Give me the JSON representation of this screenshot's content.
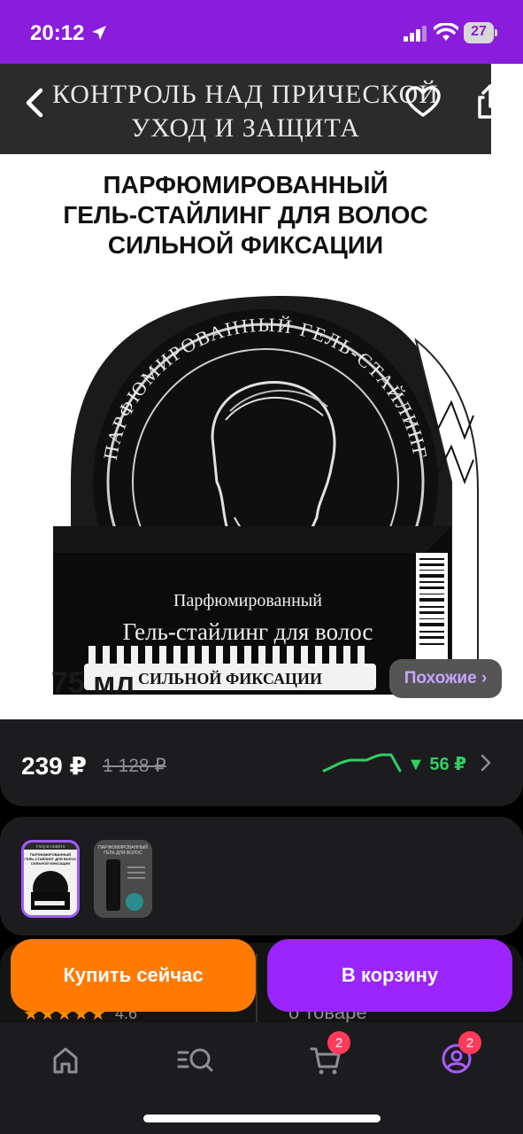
{
  "status_bar": {
    "time": "20:12",
    "battery": "27",
    "icons": [
      "location-arrow-icon",
      "signal-bars-icon",
      "wifi-icon",
      "battery-icon"
    ]
  },
  "product_image": {
    "banner_line1": "КОНТРОЛЬ НАД ПРИЧЕСКОЙ",
    "banner_line2": "УХОД И ЗАЩИТА",
    "title_line1": "ПАРФЮМИРОВАННЫЙ",
    "title_line2": "ГЕЛЬ-СТАЙЛИНГ ДЛЯ ВОЛОС",
    "title_line3": "СИЛЬНОЙ ФИКСАЦИИ",
    "jar_arc_text": "ПАРФЮМИРОВАННЫЙ ГЕЛЬ-СТАЙЛИНГ",
    "box_text1": "Парфюмированный",
    "box_text2": "Гель-стайлинг для волос",
    "box_text3": "СИЛЬНОЙ ФИКСАЦИИ",
    "volume": "75 мл"
  },
  "actions": {
    "similar": "Похожие ›",
    "buy_now": "Купить сейчас",
    "add_to_cart": "В корзину"
  },
  "price": {
    "current": "239 ₽",
    "old": "1 128 ₽",
    "drop": "▼ 56 ₽"
  },
  "thumbnails": [
    {
      "name": "thumbnail-1",
      "selected": true
    },
    {
      "name": "thumbnail-2",
      "selected": false
    }
  ],
  "thumb_texts": {
    "t1_top": "УХОД И ЗАЩИТА",
    "t1_l1": "ПАРФЮМИРОВАННЫЙ",
    "t1_l2": "ГЕЛЬ-СТАЙЛИНГ ДЛЯ ВОЛОС",
    "t1_l3": "СИЛЬНОЙ ФИКСАЦИИ",
    "t2_l1": "ПАРФЮМИРОВАННЫЙ",
    "t2_l2": "ГЕЛЬ ДЛЯ ВОЛОС"
  },
  "reviews": {
    "stars": "★★★★★",
    "rating": "4.6"
  },
  "about": "о товаре",
  "tab_bar": {
    "cart_badge": "2",
    "profile_badge": "2"
  },
  "colors": {
    "status_bar": "#8a1cdb",
    "buy_button": "#ff7a00",
    "cart_button": "#9b24ff",
    "price_drop": "#2fd064",
    "badge": "#ff3b5c"
  }
}
